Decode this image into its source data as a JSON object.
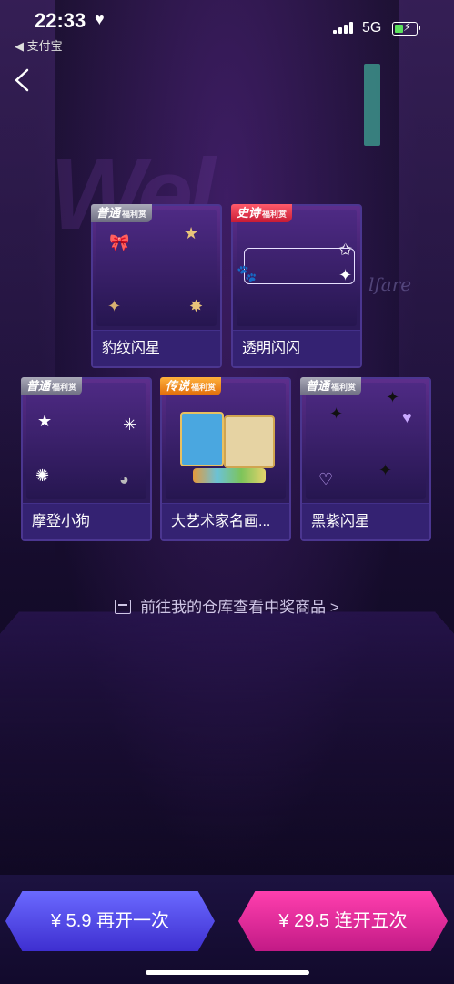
{
  "status_bar": {
    "time": "22:33",
    "heart": "♥",
    "back_app": "◀ 支付宝",
    "network": "5G"
  },
  "nav": {
    "back_icon": "chevron-left-icon"
  },
  "background": {
    "script_text": "lfare"
  },
  "prizes": [
    {
      "tier": "普通",
      "tier_sub": "福利赏",
      "name": "豹纹闪星"
    },
    {
      "tier": "史诗",
      "tier_sub": "福利赏",
      "name": "透明闪闪"
    },
    {
      "tier": "普通",
      "tier_sub": "福利赏",
      "name": "摩登小狗"
    },
    {
      "tier": "传说",
      "tier_sub": "福利赏",
      "name": "大艺术家名画..."
    },
    {
      "tier": "普通",
      "tier_sub": "福利赏",
      "name": "黑紫闪星"
    }
  ],
  "warehouse_link": {
    "label": "前往我的仓库查看中奖商品 >"
  },
  "actions": {
    "open_once": "¥ 5.9 再开一次",
    "open_five": "¥ 29.5 连开五次"
  },
  "colors": {
    "normal_tag": "#8a8aa0",
    "epic_tag": "#e0283f",
    "legend_tag": "#f08a1a",
    "blue_button": "#4f45e6",
    "pink_button": "#e02a9c"
  }
}
